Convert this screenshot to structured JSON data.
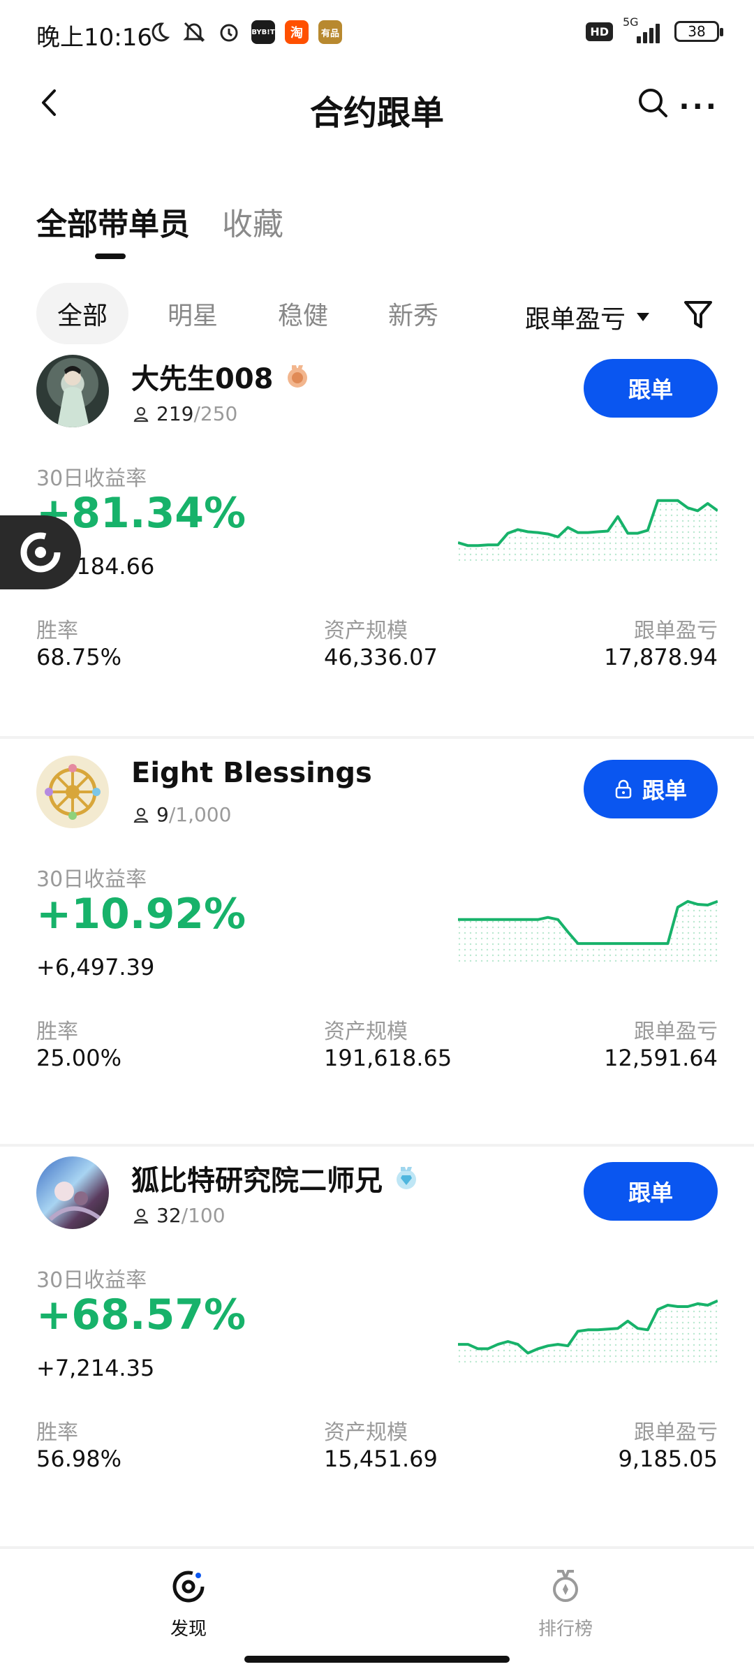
{
  "status_bar": {
    "time": "晚上10:16",
    "network": "5G",
    "battery": "38",
    "hd_label": "HD",
    "app_icons": [
      {
        "name": "bybit-app-icon",
        "label": "BYB!T",
        "color": "#1b1b1b"
      },
      {
        "name": "taobao-app-icon",
        "label": "淘",
        "color": "#ff5000"
      },
      {
        "name": "youpin-app-icon",
        "label": "有品",
        "color": "#b8892f"
      }
    ]
  },
  "header": {
    "title": "合约跟单"
  },
  "main_tabs": [
    {
      "label": "全部带单员",
      "active": true
    },
    {
      "label": "收藏",
      "active": false
    }
  ],
  "filter_chips": [
    {
      "label": "全部",
      "active": true
    },
    {
      "label": "明星",
      "active": false
    },
    {
      "label": "稳健",
      "active": false
    },
    {
      "label": "新秀",
      "active": false
    }
  ],
  "sort": {
    "label": "跟单盈亏"
  },
  "stat_labels": {
    "roi": "30日收益率",
    "win_rate": "胜率",
    "aum": "资产规模",
    "follow_pnl": "跟单盈亏"
  },
  "traders": [
    {
      "name": "大先生008",
      "medal": "bronze",
      "followers": "219",
      "capacity": "/250",
      "button": "跟单",
      "locked": false,
      "roi": "+81.34%",
      "pnl": "+2,184.66",
      "win_rate": "68.75%",
      "aum": "46,336.07",
      "follow_pnl": "17,878.94",
      "sparkline": [
        22,
        18,
        18,
        19,
        19,
        35,
        40,
        37,
        36,
        34,
        30,
        43,
        36,
        36,
        37,
        38,
        58,
        35,
        35,
        39,
        80,
        80,
        80,
        70,
        66,
        76,
        66
      ]
    },
    {
      "name": "Eight Blessings",
      "medal": "",
      "followers": "9",
      "capacity": "/1,000",
      "button": "跟单",
      "locked": true,
      "roi": "+10.92%",
      "pnl": "+6,497.39",
      "win_rate": "25.00%",
      "aum": "191,618.65",
      "follow_pnl": "12,591.64",
      "sparkline": [
        55,
        55,
        55,
        55,
        55,
        55,
        55,
        55,
        55,
        58,
        55,
        38,
        22,
        22,
        22,
        22,
        22,
        22,
        22,
        22,
        22,
        22,
        72,
        80,
        76,
        75,
        80
      ]
    },
    {
      "name": "狐比特研究院二师兄",
      "medal": "diamond",
      "followers": "32",
      "capacity": "/100",
      "button": "跟单",
      "locked": false,
      "roi": "+68.57%",
      "pnl": "+7,214.35",
      "win_rate": "56.98%",
      "aum": "15,451.69",
      "follow_pnl": "9,185.05",
      "sparkline": [
        22,
        22,
        16,
        16,
        22,
        26,
        22,
        10,
        16,
        20,
        22,
        20,
        40,
        42,
        42,
        43,
        44,
        54,
        44,
        42,
        70,
        76,
        74,
        74,
        78,
        76,
        82
      ]
    }
  ],
  "bottom_nav": [
    {
      "label": "发现",
      "active": true
    },
    {
      "label": "排行榜",
      "active": false
    }
  ],
  "colors": {
    "accent_blue": "#0a56f0",
    "profit_green": "#17b26a",
    "muted": "#9a9a9a"
  }
}
